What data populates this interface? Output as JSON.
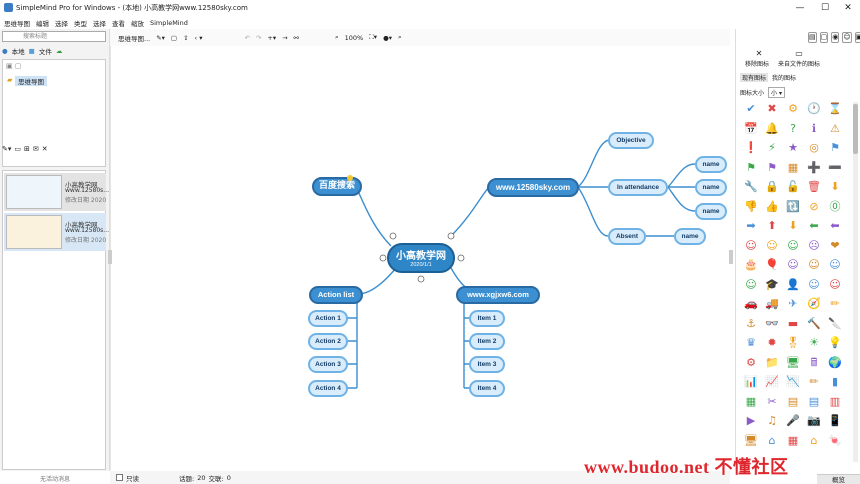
{
  "window": {
    "title": "SimpleMind Pro for Windows - (本地) 小高教学网www.12580sky.com",
    "min": "—",
    "max": "☐",
    "close": "✕"
  },
  "menu": [
    "思维导图",
    "编辑",
    "选择",
    "类型",
    "选择",
    "查看",
    "缩放",
    "SimpleMind"
  ],
  "left": {
    "search_placeholder": "搜索标题",
    "tab_local": "本地",
    "tab_files": "文件",
    "tree_item": "思维导图",
    "docs": [
      {
        "title": "小高教学网",
        "sub": "www.12580s...",
        "date": "修改日期 2020"
      },
      {
        "title": "小高教学网",
        "sub": "www.12580s...",
        "date": "修改日期 2020"
      }
    ],
    "status": "无活动消息"
  },
  "toolbar": {
    "doc": "思维导图...",
    "zoom": "100%"
  },
  "map": {
    "center": {
      "title": "小高教学网",
      "date": "2020/1/1"
    },
    "baidu": "百度搜索",
    "site": "www.12580sky.com",
    "objective": "Objective",
    "in_attendance": "In attendance",
    "absent": "Absent",
    "name1": "name",
    "name2": "name",
    "name3": "name",
    "name4": "name",
    "action_list": "Action list",
    "actions": [
      "Action 1",
      "Action 2",
      "Action 3",
      "Action 4"
    ],
    "xgjxw": "www.xgjxw6.com",
    "items": [
      "Item 1",
      "Item 2",
      "Item 3",
      "Item 4"
    ]
  },
  "right": {
    "remove_icon": "移除图标",
    "from_file": "来自文件的图标",
    "tab_lib": "现有图标",
    "tab_mine": "我的图标",
    "size_label": "图标大小",
    "size_value": "小"
  },
  "status": {
    "readonly": "只读",
    "topics": "话题:",
    "topics_count": "20",
    "links": "交联:",
    "links_count": "0",
    "overview": "概览"
  },
  "watermark": "www.budoo.net 不懂社区",
  "icons": [
    [
      "✔",
      "✖",
      "⚙",
      "🕐",
      "⌛"
    ],
    [
      "📅",
      "🔔",
      "?",
      "ℹ",
      "⚠"
    ],
    [
      "❗",
      "⚡",
      "★",
      "◎",
      "⚑"
    ],
    [
      "⚑",
      "⚑",
      "▦",
      "➕",
      "➖"
    ],
    [
      "🔧",
      "🔒",
      "🔓",
      "🗑",
      "⬇"
    ],
    [
      "👎",
      "👍",
      "🔃",
      "⊘",
      "⓪"
    ],
    [
      "➡",
      "⬆",
      "⬇",
      "⬅",
      "⬅"
    ],
    [
      "☺",
      "☺",
      "☺",
      "☹",
      "❤"
    ],
    [
      "🎂",
      "🎈",
      "☺",
      "☺",
      "☺"
    ],
    [
      "☺",
      "🎓",
      "👤",
      "☺",
      "☺"
    ],
    [
      "🚗",
      "🚚",
      "✈",
      "🧭",
      "✏"
    ],
    [
      "⚓",
      "👓",
      "▬",
      "🔨",
      "🔪"
    ],
    [
      "♛",
      "✹",
      "🎖",
      "☀",
      "💡"
    ],
    [
      "⚙",
      "📁",
      "🖥",
      "🖩",
      "🌍"
    ],
    [
      "📊",
      "📈",
      "📉",
      "✏",
      "▮"
    ],
    [
      "▦",
      "✂",
      "▤",
      "▤",
      "▥"
    ],
    [
      "▶",
      "♫",
      "🎤",
      "📷",
      "📱"
    ],
    [
      "🖥",
      "⌂",
      "▦",
      "⌂",
      "🍬"
    ]
  ],
  "colors": {
    "accent": "#3c8fd0",
    "branch": "#3c8fd0"
  }
}
